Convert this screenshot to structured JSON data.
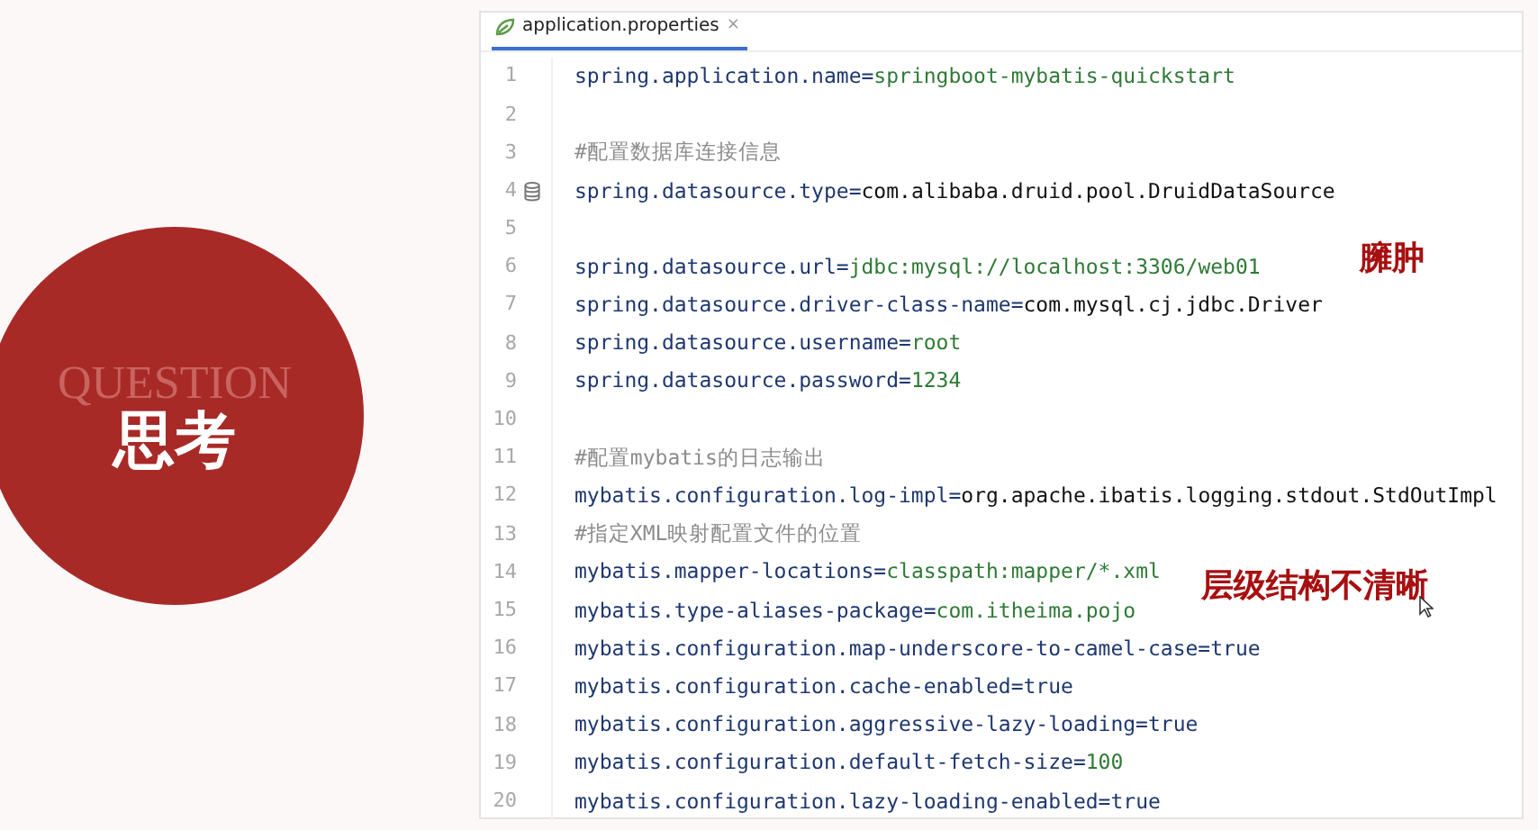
{
  "slide": {
    "badge_caption": "QUESTION",
    "badge_title": "思考"
  },
  "editor": {
    "tab": {
      "label": "application.properties",
      "close": "×",
      "selected": true
    },
    "lines": [
      {
        "number": "1",
        "kind": "property",
        "key": "spring.application.name=",
        "value": {
          "kind": "string",
          "text": "springboot-mybatis-quickstart"
        }
      },
      {
        "number": "2",
        "kind": "blank"
      },
      {
        "number": "3",
        "kind": "comment",
        "text": "#配置数据库连接信息"
      },
      {
        "number": "4",
        "kind": "property",
        "key": "spring.datasource.type=",
        "value": {
          "kind": "class",
          "text": "com.alibaba.druid.pool.DruidDataSource"
        },
        "gutter_icon": true
      },
      {
        "number": "5",
        "kind": "blank"
      },
      {
        "number": "6",
        "kind": "property",
        "key": "spring.datasource.url=",
        "value": {
          "kind": "string",
          "text": "jdbc:mysql://localhost:3306/web01"
        }
      },
      {
        "number": "7",
        "kind": "property",
        "key": "spring.datasource.driver-class-name=",
        "value": {
          "kind": "class",
          "text": "com.mysql.cj.jdbc.Driver"
        }
      },
      {
        "number": "8",
        "kind": "property",
        "key": "spring.datasource.username=",
        "value": {
          "kind": "string",
          "text": "root"
        }
      },
      {
        "number": "9",
        "kind": "property",
        "key": "spring.datasource.password=",
        "value": {
          "kind": "string",
          "text": "1234"
        }
      },
      {
        "number": "10",
        "kind": "blank"
      },
      {
        "number": "11",
        "kind": "comment",
        "text": "#配置mybatis的日志输出"
      },
      {
        "number": "12",
        "kind": "property",
        "key": "mybatis.configuration.log-impl=",
        "value": {
          "kind": "class",
          "text": "org.apache.ibatis.logging.stdout.StdOutImpl"
        }
      },
      {
        "number": "13",
        "kind": "comment",
        "text": "#指定XML映射配置文件的位置"
      },
      {
        "number": "14",
        "kind": "property",
        "key": "mybatis.mapper-locations=",
        "value": {
          "kind": "string",
          "text": "classpath:mapper/*.xml"
        }
      },
      {
        "number": "15",
        "kind": "property",
        "key": "mybatis.type-aliases-package=",
        "value": {
          "kind": "string",
          "text": "com.itheima.pojo"
        }
      },
      {
        "number": "16",
        "kind": "property",
        "key": "mybatis.configuration.map-underscore-to-camel-case=",
        "value": {
          "kind": "keyword",
          "text": "true"
        }
      },
      {
        "number": "17",
        "kind": "property",
        "key": "mybatis.configuration.cache-enabled=",
        "value": {
          "kind": "keyword",
          "text": "true"
        }
      },
      {
        "number": "18",
        "kind": "property",
        "key": "mybatis.configuration.aggressive-lazy-loading=",
        "value": {
          "kind": "keyword",
          "text": "true"
        }
      },
      {
        "number": "19",
        "kind": "property",
        "key": "mybatis.configuration.default-fetch-size=",
        "value": {
          "kind": "string",
          "text": "100"
        }
      },
      {
        "number": "20",
        "kind": "property",
        "key": "mybatis.configuration.lazy-loading-enabled=",
        "value": {
          "kind": "keyword",
          "text": "true"
        }
      }
    ]
  },
  "annotations": [
    "臃肿",
    "层级结构不清晰"
  ]
}
